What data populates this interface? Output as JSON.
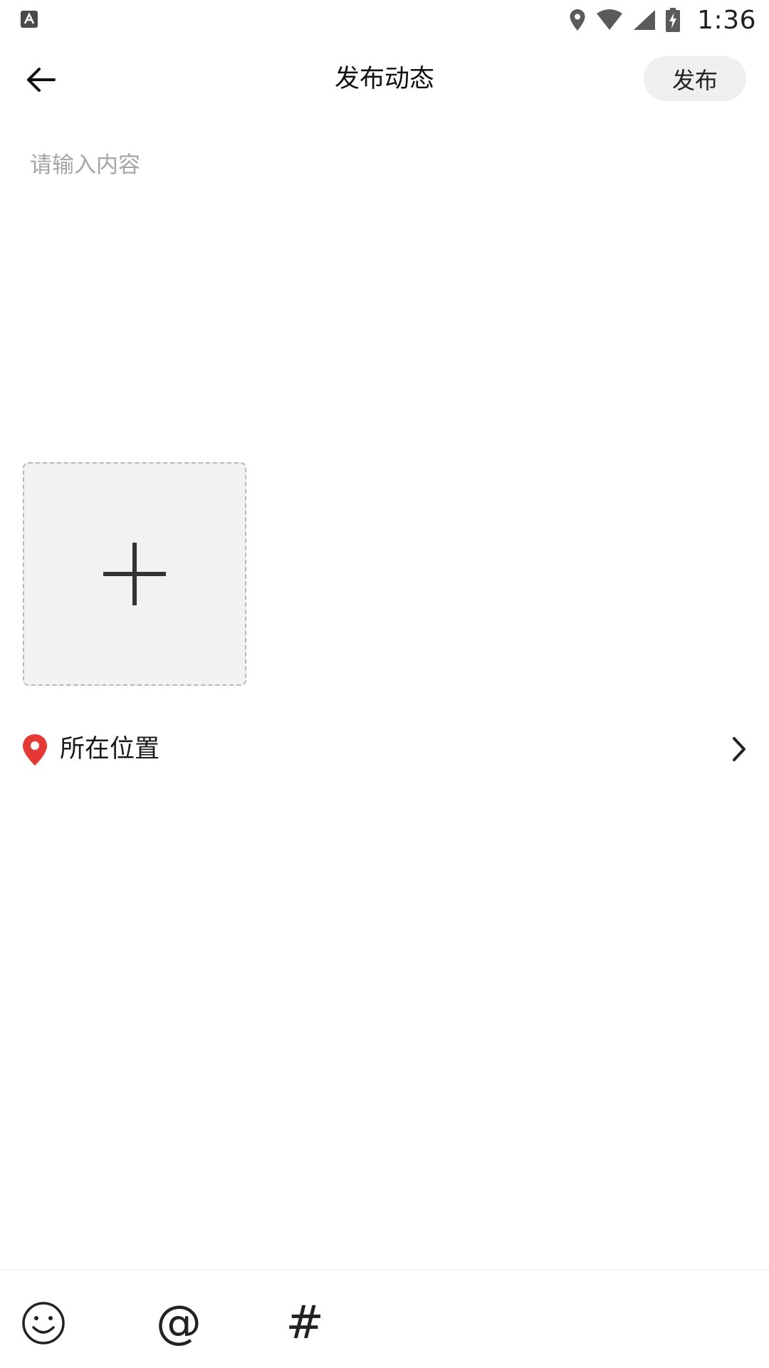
{
  "status_bar": {
    "time": "1:36",
    "icons": [
      "app-notification-icon",
      "location-icon",
      "wifi-icon",
      "signal-icon",
      "battery-charging-icon"
    ]
  },
  "header": {
    "title": "发布动态",
    "publish_label": "发布",
    "back_icon": "arrow-left-icon"
  },
  "editor": {
    "value": "",
    "placeholder": "请输入内容"
  },
  "media": {
    "add_icon": "plus-icon"
  },
  "location": {
    "label": "所在位置",
    "icon": "location-pin-icon",
    "pin_color": "#e53935",
    "chevron_icon": "chevron-right-icon"
  },
  "toolbar": {
    "at_glyph": "@",
    "hash_glyph": "#",
    "items": [
      "emoji-icon",
      "at-mention-icon",
      "hashtag-icon"
    ]
  }
}
